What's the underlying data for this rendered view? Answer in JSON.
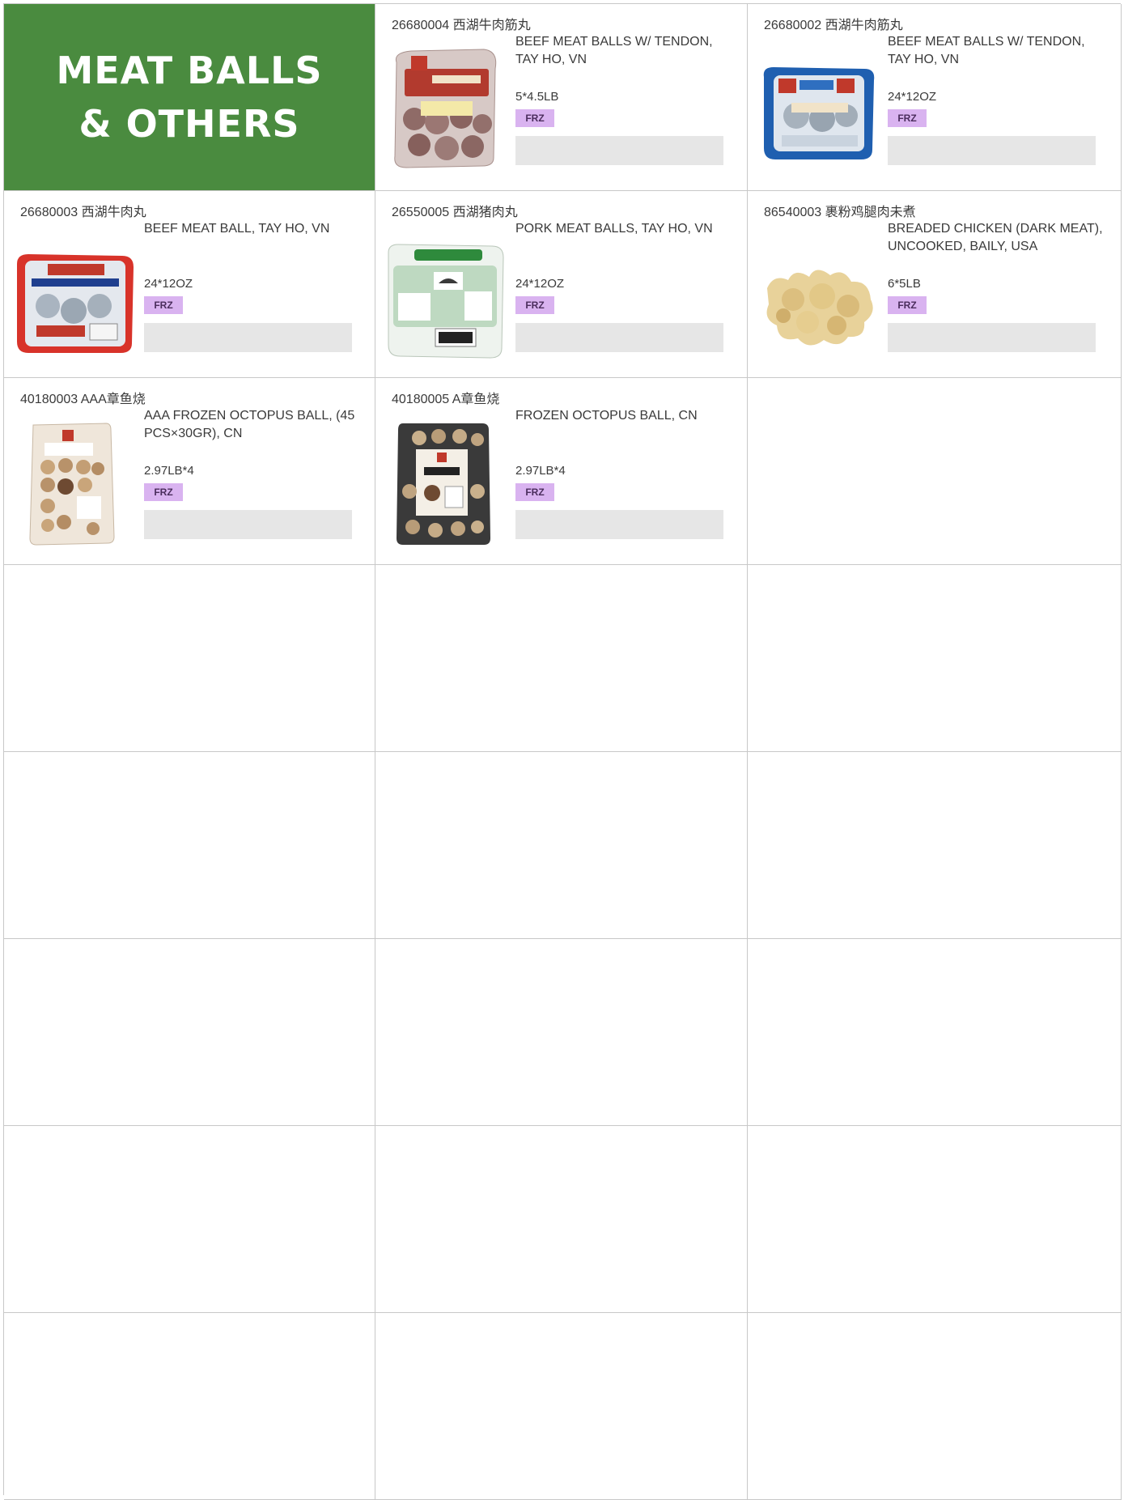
{
  "header": {
    "title_line1": "MEAT BALLS",
    "title_line2": "& OTHERS"
  },
  "products": [
    {
      "code": "26680004 西湖牛肉筋丸",
      "description": "BEEF MEAT BALLS W/ TENDON, TAY HO, VN",
      "pack": "5*4.5LB",
      "storage": "FRZ",
      "image": "beef-tendon-ball-bag-photo",
      "pkg_color": "#b23a2e"
    },
    {
      "code": "26680002 西湖牛肉筋丸",
      "description": "BEEF MEAT BALLS W/ TENDON, TAY HO, VN",
      "pack": "24*12OZ",
      "storage": "FRZ",
      "image": "beef-tendon-ball-pack-photo",
      "pkg_color": "#1f5fb0"
    },
    {
      "code": "26680003 西湖牛肉丸",
      "description": "BEEF MEAT BALL, TAY HO, VN",
      "pack": "24*12OZ",
      "storage": "FRZ",
      "image": "beef-meat-ball-pack-photo",
      "pkg_color": "#d8332a"
    },
    {
      "code": "26550005 西湖猪肉丸",
      "description": "PORK MEAT BALLS, TAY HO, VN",
      "pack": "24*12OZ",
      "storage": "FRZ",
      "image": "pork-meat-ball-pack-photo",
      "pkg_color": "#2e8a3c"
    },
    {
      "code": "86540003 裹粉鸡腿肉未煮",
      "description": "BREADED CHICKEN (DARK MEAT), UNCOOKED, BAILY, USA",
      "pack": "6*5LB",
      "storage": "FRZ",
      "image": "breaded-chicken-photo",
      "pkg_color": "#e8d29a"
    },
    {
      "code": "40180003 AAA章鱼烧",
      "description": "AAA FROZEN OCTOPUS BALL, (45 PCS×30GR), CN",
      "pack": "2.97LB*4",
      "storage": "FRZ",
      "image": "octopus-ball-clear-bag-photo",
      "pkg_color": "#c9a57a"
    },
    {
      "code": "40180005 A章鱼烧",
      "description": "FROZEN OCTOPUS BALL, CN",
      "pack": "2.97LB*4",
      "storage": "FRZ",
      "image": "octopus-ball-dark-bag-photo",
      "pkg_color": "#3a3a3a"
    }
  ],
  "colors": {
    "title_green": "#4a8b3f",
    "badge_purple": "#d9b3f0",
    "price_gray": "#e6e6e6"
  }
}
